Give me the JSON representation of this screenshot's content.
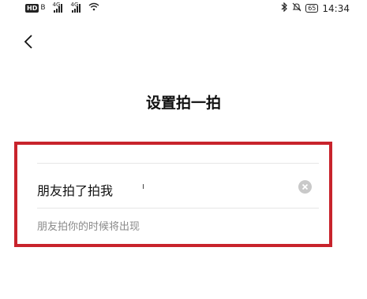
{
  "status_bar": {
    "hd_label": "HD",
    "sim_label": "B",
    "signal1_tag": "4G",
    "signal2_tag": "4G",
    "battery_level": "65",
    "time": "14:34"
  },
  "header": {
    "back_icon": "chevron-left-icon",
    "title": "设置拍一拍"
  },
  "form": {
    "input_value": "朋友拍了拍我",
    "clear_icon": "clear-circle-x-icon",
    "helper_text": "朋友拍你的时候将出现"
  },
  "colors": {
    "highlight": "#c8232c",
    "divider": "#e6e6e6",
    "helper": "#8a8a8a"
  }
}
